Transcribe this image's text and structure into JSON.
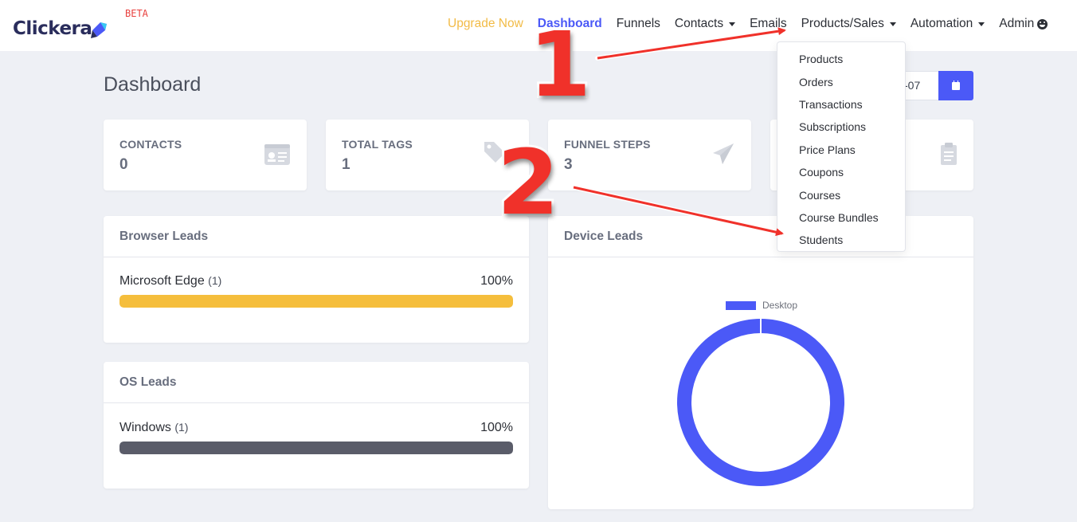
{
  "brand": {
    "name": "Clickera",
    "badge": "BETA",
    "colors": {
      "primary": "#4b59f7",
      "text_dark": "#2a2d5c",
      "accent_yellow": "#f2bb46"
    }
  },
  "nav": {
    "items": [
      {
        "label": "Upgrade Now",
        "has_caret": false
      },
      {
        "label": "Dashboard",
        "has_caret": false
      },
      {
        "label": "Funnels",
        "has_caret": false
      },
      {
        "label": "Contacts",
        "has_caret": true
      },
      {
        "label": "Emails",
        "has_caret": false
      },
      {
        "label": "Products/Sales",
        "has_caret": true
      },
      {
        "label": "Automation",
        "has_caret": true
      },
      {
        "label": "Admin",
        "has_caret": false,
        "icon": "smiley-icon"
      }
    ],
    "active": "Dashboard"
  },
  "dropdown": {
    "parent": "Products/Sales",
    "items": [
      "Products",
      "Orders",
      "Transactions",
      "Subscriptions",
      "Price Plans",
      "Coupons",
      "Courses",
      "Course Bundles",
      "Students"
    ]
  },
  "page": {
    "title": "Dashboard",
    "date_text": "-07",
    "date_button_icon": "calendar-icon"
  },
  "stats": [
    {
      "label": "CONTACTS",
      "value": "0",
      "icon": "id-card-icon"
    },
    {
      "label": "TOTAL TAGS",
      "value": "1",
      "icon": "tags-icon"
    },
    {
      "label": "FUNNEL STEPS",
      "value": "3",
      "icon": "paper-plane-icon"
    },
    {
      "label": "",
      "value": "",
      "icon": "clipboard-icon"
    }
  ],
  "browser_leads": {
    "title": "Browser Leads",
    "rows": [
      {
        "name": "Microsoft Edge",
        "count": "(1)",
        "percent": "100%",
        "fill": 1.0,
        "color": "#f5be3c"
      }
    ]
  },
  "os_leads": {
    "title": "OS Leads",
    "rows": [
      {
        "name": "Windows",
        "count": "(1)",
        "percent": "100%",
        "fill": 1.0,
        "color": "#5a5c69"
      }
    ]
  },
  "device_leads": {
    "title": "Device Leads"
  },
  "chart_data": {
    "type": "pie",
    "categories": [
      "Desktop"
    ],
    "values": [
      1
    ],
    "colors": [
      "#4b59f7"
    ],
    "legend_position": "top"
  },
  "annotations": {
    "step1": "1",
    "step2": "2",
    "arrow_color": "#f0312a"
  }
}
